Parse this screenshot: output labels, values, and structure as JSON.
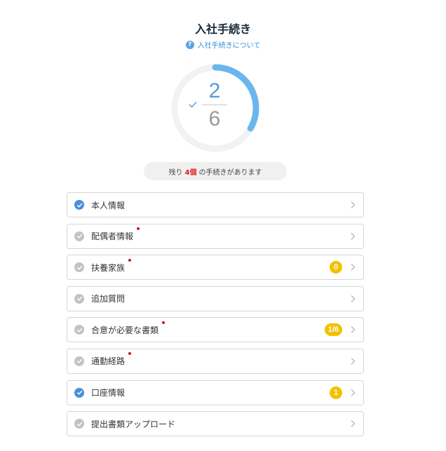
{
  "header": {
    "title": "入社手続き",
    "help_label": "入社手続きについて",
    "help_icon": "question-circle-icon"
  },
  "progress": {
    "completed": "2",
    "total": "6",
    "fraction": 0.333,
    "arc_color": "#6bb6ee",
    "check_icon": "check-icon"
  },
  "remaining": {
    "prefix": "残り",
    "count": "4個",
    "suffix": "の手続きがあります"
  },
  "items": [
    {
      "label": "本人情報",
      "done": true,
      "dot": false,
      "badge": ""
    },
    {
      "label": "配偶者情報",
      "done": false,
      "dot": true,
      "badge": ""
    },
    {
      "label": "扶養家族",
      "done": false,
      "dot": true,
      "badge": "0"
    },
    {
      "label": "追加質問",
      "done": false,
      "dot": false,
      "badge": ""
    },
    {
      "label": "合意が必要な書類",
      "done": false,
      "dot": true,
      "badge": "1/6"
    },
    {
      "label": "通勤経路",
      "done": false,
      "dot": true,
      "badge": ""
    },
    {
      "label": "口座情報",
      "done": true,
      "dot": false,
      "badge": "1"
    },
    {
      "label": "提出書類アップロード",
      "done": false,
      "dot": false,
      "badge": ""
    }
  ],
  "colors": {
    "accent": "#4a90d9",
    "badge": "#f2c200",
    "alert_dot": "#d0161b",
    "pending": "#c3c3c3"
  }
}
